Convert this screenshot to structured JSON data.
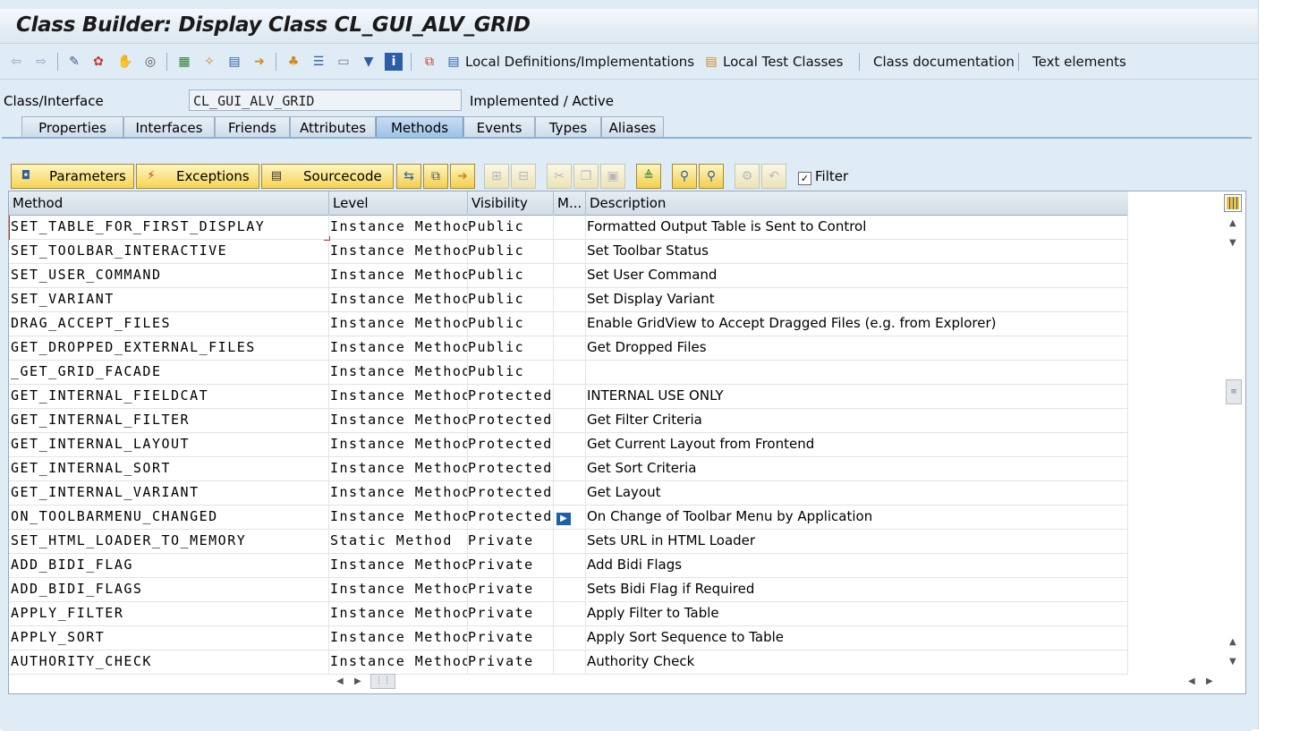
{
  "window": {
    "title": "Class Builder: Display Class CL_GUI_ALV_GRID"
  },
  "toolbar": {
    "icons": [
      "back-arrow-icon",
      "forward-arrow-icon",
      "other-object-icon",
      "display-change-icon",
      "active-inactive-icon",
      "check-icon",
      "test-icon",
      "object-list-icon",
      "where-used-icon",
      "navigate-icon",
      "hierarchy-icon",
      "superclass-icon",
      "class-docu-icon",
      "filter-icon",
      "info-icon",
      "local-types-icon"
    ],
    "local_definitions_label": "Local Definitions/Implementations",
    "local_test_classes_label": "Local Test Classes",
    "class_documentation_label": "Class documentation",
    "text_elements_label": "Text elements"
  },
  "header": {
    "class_label": "Class/Interface",
    "class_value": "CL_GUI_ALV_GRID",
    "status": "Implemented / Active"
  },
  "tabs": [
    {
      "label": "Properties"
    },
    {
      "label": "Interfaces"
    },
    {
      "label": "Friends"
    },
    {
      "label": "Attributes"
    },
    {
      "label": "Methods"
    },
    {
      "label": "Events"
    },
    {
      "label": "Types"
    },
    {
      "label": "Aliases"
    }
  ],
  "active_tab": "Methods",
  "method_buttons": {
    "parameters": "Parameters",
    "exceptions": "Exceptions",
    "sourcecode": "Sourcecode",
    "filter_label": "Filter",
    "filter_checked": true
  },
  "grid": {
    "columns": [
      "Method",
      "Level",
      "Visibility",
      "M...",
      "Description"
    ],
    "rows": [
      {
        "method": "SET_TABLE_FOR_FIRST_DISPLAY",
        "level": "Instance Method",
        "visibility": "Public",
        "m": "",
        "description": "Formatted Output Table is Sent to Control"
      },
      {
        "method": "SET_TOOLBAR_INTERACTIVE",
        "level": "Instance Method",
        "visibility": "Public",
        "m": "",
        "description": "Set Toolbar Status"
      },
      {
        "method": "SET_USER_COMMAND",
        "level": "Instance Method",
        "visibility": "Public",
        "m": "",
        "description": "Set User Command"
      },
      {
        "method": "SET_VARIANT",
        "level": "Instance Method",
        "visibility": "Public",
        "m": "",
        "description": "Set Display Variant"
      },
      {
        "method": "DRAG_ACCEPT_FILES",
        "level": "Instance Method",
        "visibility": "Public",
        "m": "",
        "description": "Enable GridView to Accept Dragged Files (e.g. from Explorer)"
      },
      {
        "method": "GET_DROPPED_EXTERNAL_FILES",
        "level": "Instance Method",
        "visibility": "Public",
        "m": "",
        "description": "Get Dropped Files"
      },
      {
        "method": "_GET_GRID_FACADE",
        "level": "Instance Method",
        "visibility": "Public",
        "m": "",
        "description": ""
      },
      {
        "method": "GET_INTERNAL_FIELDCAT",
        "level": "Instance Method",
        "visibility": "Protected",
        "m": "",
        "description": "INTERNAL USE ONLY"
      },
      {
        "method": "GET_INTERNAL_FILTER",
        "level": "Instance Method",
        "visibility": "Protected",
        "m": "",
        "description": "Get Filter Criteria"
      },
      {
        "method": "GET_INTERNAL_LAYOUT",
        "level": "Instance Method",
        "visibility": "Protected",
        "m": "",
        "description": "Get Current Layout from Frontend"
      },
      {
        "method": "GET_INTERNAL_SORT",
        "level": "Instance Method",
        "visibility": "Protected",
        "m": "",
        "description": "Get Sort Criteria"
      },
      {
        "method": "GET_INTERNAL_VARIANT",
        "level": "Instance Method",
        "visibility": "Protected",
        "m": "",
        "description": "Get Layout"
      },
      {
        "method": "ON_TOOLBARMENU_CHANGED",
        "level": "Instance Method",
        "visibility": "Protected",
        "m": "event-handler-icon",
        "description": "On Change of Toolbar Menu by Application"
      },
      {
        "method": "SET_HTML_LOADER_TO_MEMORY",
        "level": "Static Method",
        "visibility": "Private",
        "m": "",
        "description": "Sets URL in HTML Loader"
      },
      {
        "method": "ADD_BIDI_FLAG",
        "level": "Instance Method",
        "visibility": "Private",
        "m": "",
        "description": "Add Bidi Flags"
      },
      {
        "method": "ADD_BIDI_FLAGS",
        "level": "Instance Method",
        "visibility": "Private",
        "m": "",
        "description": "Sets Bidi Flag if Required"
      },
      {
        "method": "APPLY_FILTER",
        "level": "Instance Method",
        "visibility": "Private",
        "m": "",
        "description": "Apply Filter to Table"
      },
      {
        "method": "APPLY_SORT",
        "level": "Instance Method",
        "visibility": "Private",
        "m": "",
        "description": "Apply Sort Sequence to Table"
      },
      {
        "method": "AUTHORITY_CHECK",
        "level": "Instance Method",
        "visibility": "Private",
        "m": "",
        "description": "Authority Check"
      }
    ]
  },
  "colors": {
    "app_bg": "#dfebf5",
    "button_yellow": "#f6d456",
    "active_tab": "#9cc2e6",
    "selection_red": "#c0392b"
  }
}
